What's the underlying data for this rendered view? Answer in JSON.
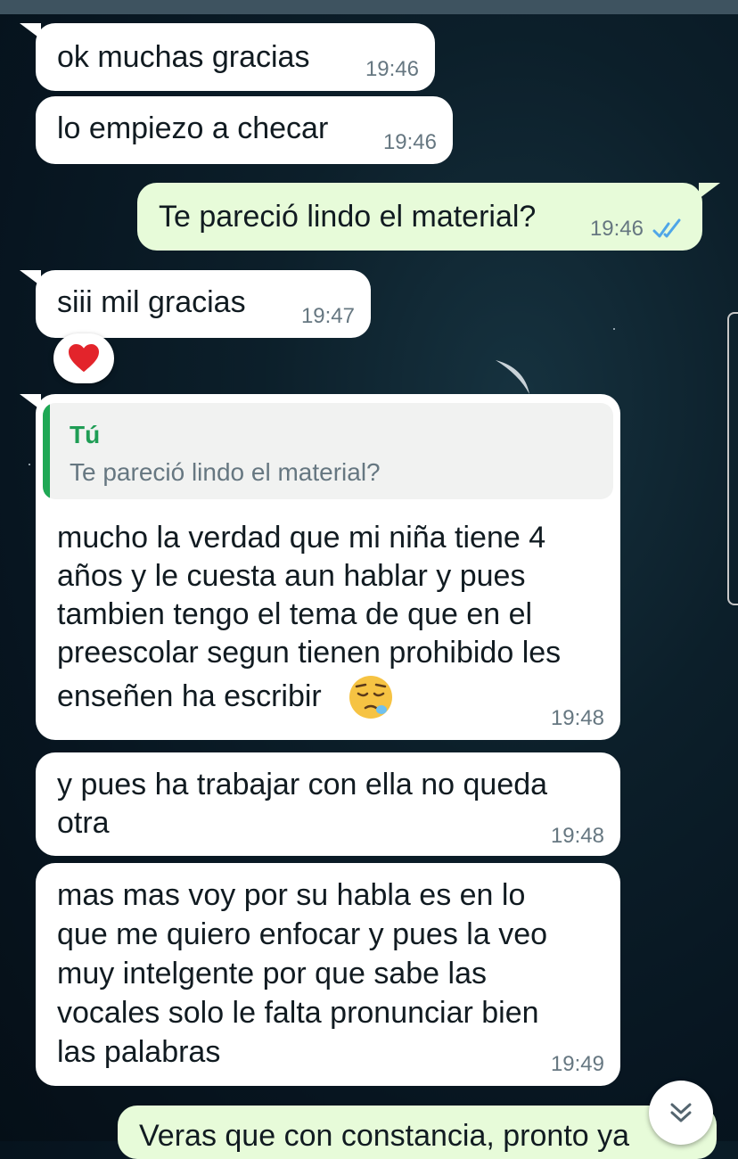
{
  "messages": [
    {
      "text": "ok muchas gracias",
      "time": "19:46",
      "direction": "incoming"
    },
    {
      "text": "lo empiezo a checar",
      "time": "19:46",
      "direction": "incoming"
    },
    {
      "text": "Te pareció lindo el material?",
      "time": "19:46",
      "direction": "outgoing",
      "status": "read"
    },
    {
      "text": "siii mil gracias",
      "time": "19:47",
      "direction": "incoming",
      "reaction": "red-heart"
    },
    {
      "lines": [
        "mucho la verdad que mi niña tiene 4",
        "años y le cuesta aun hablar y pues",
        "tambien tengo el tema de que en el",
        "preescolar segun tienen prohibido les",
        "enseñen ha escribir"
      ],
      "emoji": "sleepy-face",
      "time": "19:48",
      "direction": "incoming",
      "reply": {
        "author": "Tú",
        "text": "Te pareció lindo el material?"
      }
    },
    {
      "lines": [
        "y pues ha trabajar con ella no queda",
        "otra"
      ],
      "time": "19:48",
      "direction": "incoming"
    },
    {
      "lines": [
        "mas mas voy por su habla es en lo",
        "que me quiero enfocar y pues la veo",
        "muy intelgente por que sabe las",
        "vocales solo le falta pronunciar bien",
        "las palabras"
      ],
      "time": "19:49",
      "direction": "incoming"
    },
    {
      "text": "Veras que con constancia, pronto ya",
      "direction": "outgoing",
      "partial": true
    }
  ],
  "colors": {
    "incoming": "#ffffff",
    "outgoing": "#e7fbd9",
    "read_ticks": "#4fa6e8",
    "reply_accent": "#1fa855"
  },
  "icons": {
    "read_status": "double-check-icon",
    "reaction": "heart-icon",
    "scroll": "chevron-double-down-icon"
  }
}
